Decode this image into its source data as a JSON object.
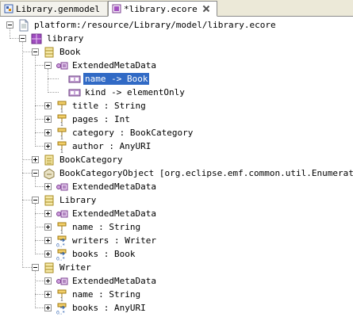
{
  "tabs": [
    {
      "label": "Library.genmodel"
    },
    {
      "label": "*library.ecore"
    }
  ],
  "tree": [
    {
      "label": "platform:/resource/Library/model/library.ecore",
      "icon": "resource-file-icon"
    },
    {
      "label": "library",
      "icon": "epackage-icon"
    },
    {
      "label": "Book",
      "icon": "eclass-icon"
    },
    {
      "label": "ExtendedMetaData",
      "icon": "eannotation-icon"
    },
    {
      "label": "name -> Book",
      "icon": "details-entry-icon"
    },
    {
      "label": "kind -> elementOnly",
      "icon": "details-entry-icon"
    },
    {
      "label": "title : String",
      "icon": "eattribute-icon"
    },
    {
      "label": "pages : Int",
      "icon": "eattribute-icon"
    },
    {
      "label": "category : BookCategory",
      "icon": "eattribute-icon"
    },
    {
      "label": "author : AnyURI",
      "icon": "eattribute-icon"
    },
    {
      "label": "BookCategory",
      "icon": "eenum-icon"
    },
    {
      "label": "BookCategoryObject [org.eclipse.emf.common.util.Enumerator]",
      "icon": "edatatype-icon"
    },
    {
      "label": "ExtendedMetaData",
      "icon": "eannotation-icon"
    },
    {
      "label": "Library",
      "icon": "eclass-icon"
    },
    {
      "label": "ExtendedMetaData",
      "icon": "eannotation-icon"
    },
    {
      "label": "name : String",
      "icon": "eattribute-icon"
    },
    {
      "label": "writers : Writer",
      "icon": "ereference-icon"
    },
    {
      "label": "books : Book",
      "icon": "ereference-icon"
    },
    {
      "label": "Writer",
      "icon": "eclass-icon"
    },
    {
      "label": "ExtendedMetaData",
      "icon": "eannotation-icon"
    },
    {
      "label": "name : String",
      "icon": "eattribute-icon"
    },
    {
      "label": "books : AnyURI",
      "icon": "ereference-icon"
    }
  ]
}
